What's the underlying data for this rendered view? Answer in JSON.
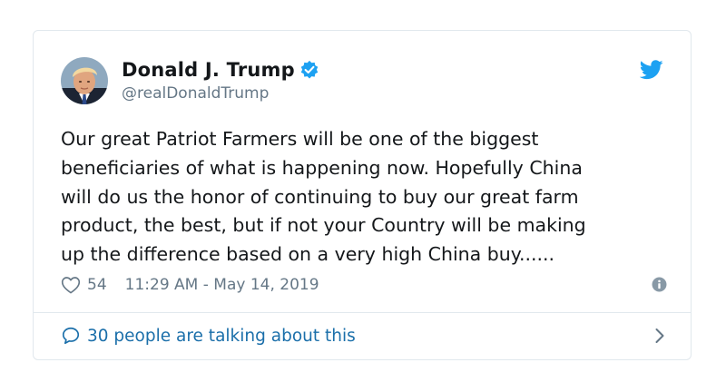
{
  "tweet": {
    "author_name": "Donald J. Trump",
    "handle": "@realDonaldTrump",
    "verified": true,
    "text": "Our great Patriot Farmers will be one of the biggest\nbeneficiaries of what is happening now. Hopefully China\nwill do us the honor of continuing to buy our great farm\nproduct, the best, but if not your Country will be making\nup the difference based on a very high China buy......",
    "like_count": "54",
    "timestamp": "11:29 AM - May 14, 2019",
    "conversation_label": "30 people are talking about this"
  },
  "icons": {
    "verified": "verified-badge-icon",
    "brand": "twitter-bird-icon",
    "like": "heart-icon",
    "info": "info-icon",
    "reply": "speech-bubble-icon",
    "more": "chevron-right-icon"
  },
  "colors": {
    "brand_blue": "#1da1f2",
    "link_blue": "#1b6faa",
    "muted_gray": "#657786",
    "border": "#e1e8ed",
    "text": "#14171a"
  }
}
